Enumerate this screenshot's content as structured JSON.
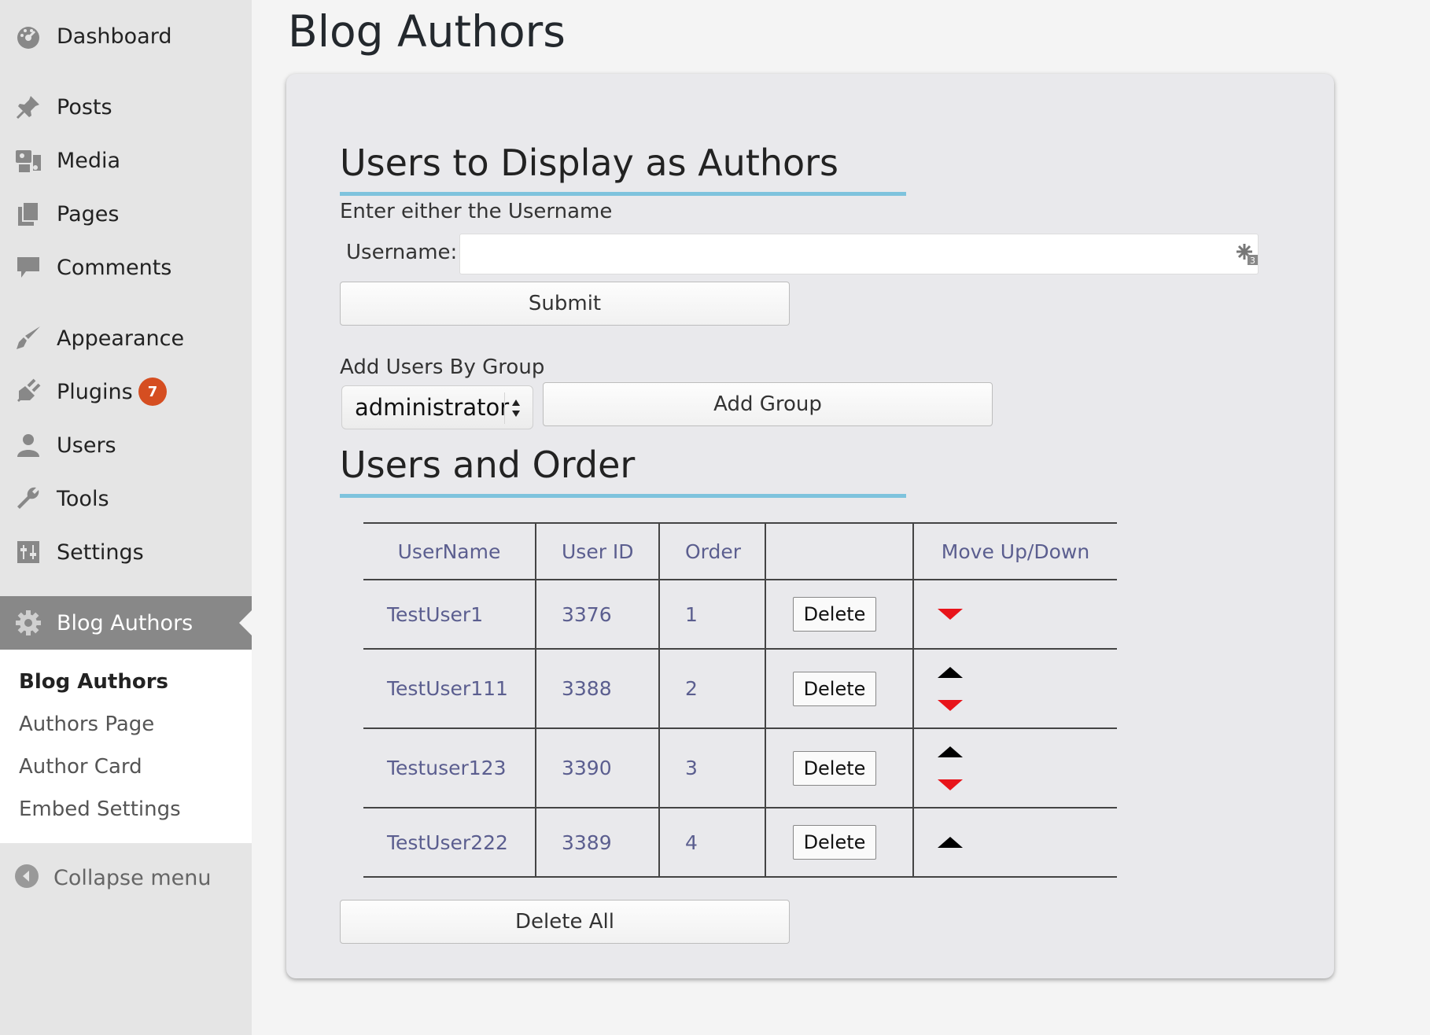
{
  "sidebar": {
    "items": [
      {
        "label": "Dashboard",
        "icon": "dashboard-icon"
      },
      {
        "label": "Posts",
        "icon": "pin-icon"
      },
      {
        "label": "Media",
        "icon": "media-icon"
      },
      {
        "label": "Pages",
        "icon": "pages-icon"
      },
      {
        "label": "Comments",
        "icon": "comment-icon"
      },
      {
        "label": "Appearance",
        "icon": "brush-icon"
      },
      {
        "label": "Plugins",
        "icon": "plug-icon",
        "badge": "7"
      },
      {
        "label": "Users",
        "icon": "user-icon"
      },
      {
        "label": "Tools",
        "icon": "wrench-icon"
      },
      {
        "label": "Settings",
        "icon": "sliders-icon"
      },
      {
        "label": "Blog Authors",
        "icon": "gear-icon",
        "active": true
      }
    ],
    "submenu": [
      "Blog Authors",
      "Authors Page",
      "Author Card",
      "Embed Settings"
    ],
    "collapse_label": "Collapse menu"
  },
  "page": {
    "title": "Blog Authors"
  },
  "panel": {
    "section1_title": "Users to Display as Authors",
    "hint": "Enter either the Username",
    "username_label": "Username:",
    "username_value": "",
    "submit_label": "Submit",
    "group_label": "Add Users By Group",
    "group_selected": "administrator",
    "add_group_label": "Add Group",
    "section2_title": "Users and Order",
    "table": {
      "headers": [
        "UserName",
        "User ID",
        "Order",
        "",
        "Move Up/Down"
      ],
      "rows": [
        {
          "username": "TestUser1",
          "user_id": "3376",
          "order": "1",
          "delete": "Delete",
          "up": false,
          "down": true
        },
        {
          "username": "TestUser111",
          "user_id": "3388",
          "order": "2",
          "delete": "Delete",
          "up": true,
          "down": true
        },
        {
          "username": "Testuser123",
          "user_id": "3390",
          "order": "3",
          "delete": "Delete",
          "up": true,
          "down": true
        },
        {
          "username": "TestUser222",
          "user_id": "3389",
          "order": "4",
          "delete": "Delete",
          "up": true,
          "down": false
        }
      ]
    },
    "delete_all_label": "Delete All"
  },
  "colors": {
    "accent_rule": "#7ec3dd",
    "badge": "#d54e21",
    "arrow_down": "#e8141a",
    "table_text": "#5b5e8f",
    "active_menu_bg": "#888888"
  }
}
